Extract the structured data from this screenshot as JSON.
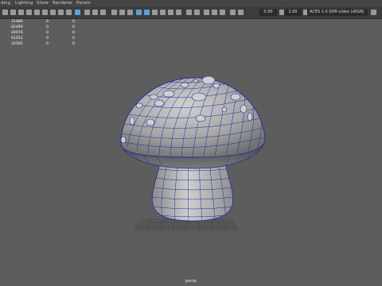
{
  "menu": {
    "items": [
      "ding",
      "Lighting",
      "Show",
      "Renderer",
      "Panels"
    ]
  },
  "toolbar": {
    "exposure_value": "0.00",
    "gamma_value": "1.00",
    "color_space": "ACES 1.0 SDR-video (sRGB)"
  },
  "hud": {
    "rows": [
      {
        "a": "31486",
        "b": "0",
        "c": "0"
      },
      {
        "a": "62490",
        "b": "0",
        "c": "0"
      },
      {
        "a": "30976",
        "b": "0",
        "c": "0"
      },
      {
        "a": "61552",
        "b": "0",
        "c": "0"
      },
      {
        "a": "32502",
        "b": "0",
        "c": "0"
      }
    ]
  },
  "viewport": {
    "camera_label": "persp"
  },
  "colors": {
    "viewport_bg": "#5d5d5d",
    "wire": "#1b2fa0",
    "accent": "#5f9fd3"
  }
}
